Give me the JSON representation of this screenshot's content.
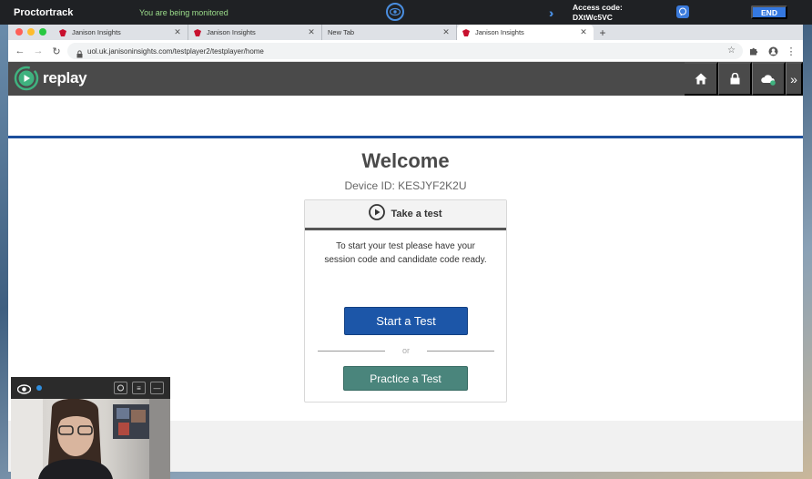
{
  "proctor": {
    "brand": "Proctortrack",
    "monitoring": "You are being monitored",
    "access_label": "Access code:",
    "access_code": "DXtWc5VC",
    "end_label": "END"
  },
  "browser": {
    "tabs": [
      {
        "label": "Janison Insights"
      },
      {
        "label": "Janison Insights"
      },
      {
        "label": "New Tab"
      },
      {
        "label": "Janison Insights"
      }
    ],
    "url": "uol.uk.janisoninsights.com/testplayer2/testplayer/home"
  },
  "app": {
    "logo_text": "replay",
    "welcome": "Welcome",
    "device_id": "Device ID: KESJYF2K2U",
    "card": {
      "title": "Take a test",
      "instructions_line1": "To start your test please have your",
      "instructions_line2": "session code and candidate code ready.",
      "start_label": "Start a Test",
      "or_label": "or",
      "practice_label": "Practice a Test"
    }
  },
  "colors": {
    "primary": "#1c56a8",
    "practice": "#4a857c",
    "header": "#4a4a4a",
    "accent_line": "#1c4f9c"
  }
}
